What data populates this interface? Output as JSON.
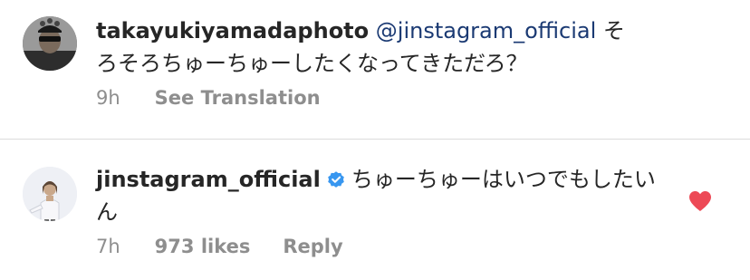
{
  "comments": [
    {
      "username": "takayukiyamadaphoto",
      "mention": "@jinstagram_official",
      "text": " そろそろちゅーちゅーしたくなってきただろ？",
      "time": "9h",
      "action": "See Translation"
    },
    {
      "username": "jinstagram_official",
      "verified": true,
      "text": "ちゅーちゅーはいつでもしたいん",
      "time": "7h",
      "likes": "973 likes",
      "action": "Reply",
      "liked": true
    }
  ],
  "colors": {
    "text": "#262626",
    "meta": "#8e8e8e",
    "mention": "#1b3a73",
    "verified": "#3897f0",
    "heart": "#ed4956",
    "divider": "#dbdbdb"
  },
  "icons": {
    "verified": "verified-badge-icon",
    "like": "heart-icon"
  }
}
